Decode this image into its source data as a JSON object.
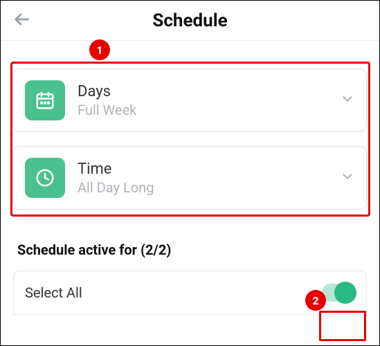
{
  "header": {
    "title": "Schedule"
  },
  "annotations": {
    "badge1": "1",
    "badge2": "2"
  },
  "cards": {
    "days": {
      "title": "Days",
      "subtitle": "Full Week"
    },
    "time": {
      "title": "Time",
      "subtitle": "All Day Long"
    }
  },
  "section": {
    "heading": "Schedule active for (2/2)"
  },
  "selectAll": {
    "label": "Select All",
    "checked": true
  }
}
